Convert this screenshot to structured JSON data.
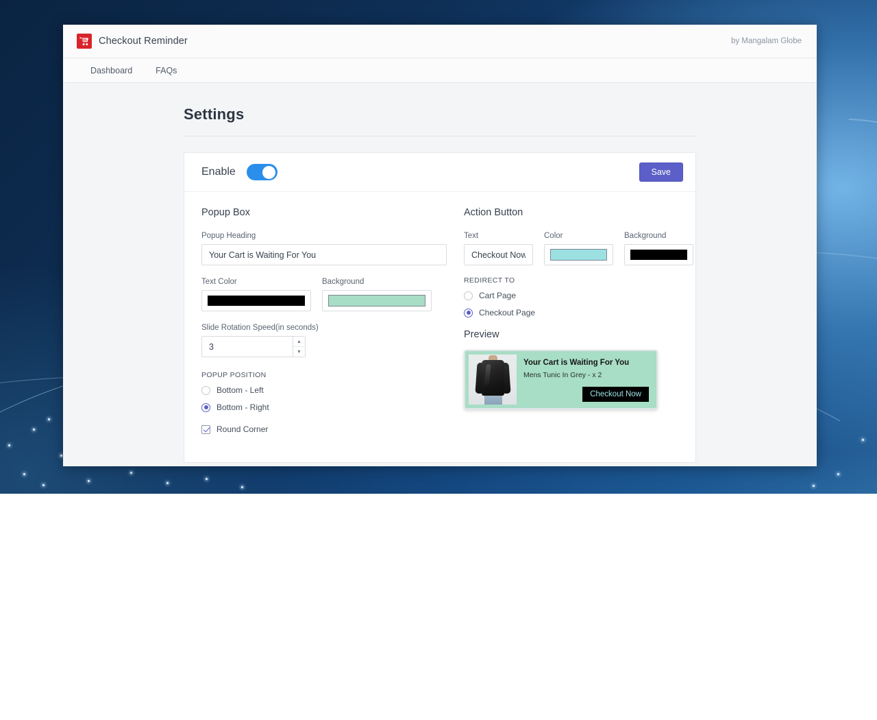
{
  "header": {
    "logo_icon": "shopping-cart-icon",
    "title": "Checkout Reminder",
    "byline": "by Mangalam Globe"
  },
  "nav": {
    "items": [
      {
        "label": "Dashboard"
      },
      {
        "label": "FAQs"
      }
    ]
  },
  "page": {
    "title": "Settings"
  },
  "card": {
    "enable_label": "Enable",
    "enable_on": true,
    "save_label": "Save"
  },
  "popup_box": {
    "section_title": "Popup Box",
    "heading_label": "Popup Heading",
    "heading_value": "Your Cart is Waiting For You",
    "text_color_label": "Text Color",
    "text_color_value": "#000000",
    "background_label": "Background",
    "background_value": "#a8ddc6",
    "speed_label": "Slide Rotation Speed(in seconds)",
    "speed_value": "3",
    "position_label": "POPUP POSITION",
    "position_options": [
      {
        "label": "Bottom - Left",
        "selected": false
      },
      {
        "label": "Bottom - Right",
        "selected": true
      }
    ],
    "round_corner_label": "Round Corner",
    "round_corner_checked": true
  },
  "action_button": {
    "section_title": "Action Button",
    "text_label": "Text",
    "text_value": "Checkout Now",
    "color_label": "Color",
    "color_value": "#9ce0e2",
    "background_label": "Background",
    "background_value": "#000000",
    "redirect_label": "REDIRECT TO",
    "redirect_options": [
      {
        "label": "Cart Page",
        "selected": false
      },
      {
        "label": "Checkout Page",
        "selected": true
      }
    ]
  },
  "preview": {
    "section_title": "Preview",
    "popup_heading": "Your Cart is Waiting For You",
    "popup_subtext": "Mens Tunic In Grey - x 2",
    "popup_cta": "Checkout Now",
    "popup_bg": "#a8ddc6",
    "cta_bg": "#000000",
    "cta_color": "#9ee0e2",
    "product_image_alt": "mens-tunic-grey-photo"
  },
  "stepper": {
    "up_glyph": "▲",
    "down_glyph": "▼"
  },
  "theme": {
    "accent": "#5b5fc7",
    "toggle_on": "#2b8eeb",
    "logo_red": "#d8242b"
  }
}
